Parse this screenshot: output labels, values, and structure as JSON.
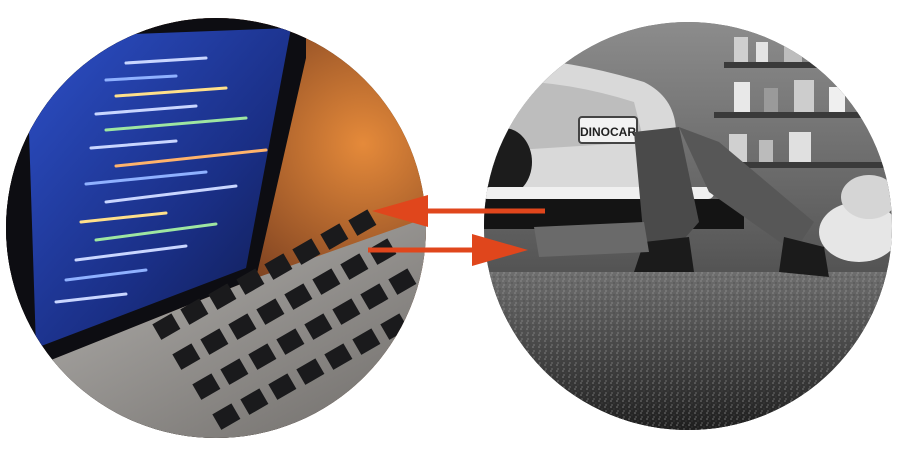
{
  "left_photo": {
    "subject": "laptop-with-code",
    "screen_color": "#1e3a9e",
    "glow_color": "#d86a1f"
  },
  "right_photo": {
    "subject": "mechanic-under-car",
    "license_plate": "DINOCAR",
    "tone": "black-and-white"
  },
  "arrows": {
    "color": "#e0461c",
    "top_direction": "left",
    "bottom_direction": "right"
  }
}
